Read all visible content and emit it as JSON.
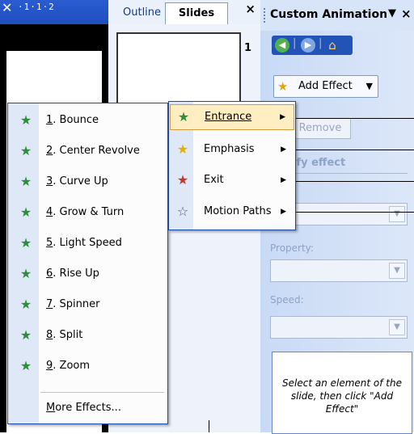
{
  "ruler": {
    "marks": "·1·1·2"
  },
  "pane_tabs": {
    "outline": "Outline",
    "slides": "Slides",
    "close": "×",
    "slide_number": "1"
  },
  "task_pane": {
    "title": "Custom Animation",
    "close": "×",
    "add_effect_label": "Add Effect",
    "remove_label": "Remove",
    "modify_label": "ify effect",
    "property_label": "Property:",
    "speed_label": "Speed:",
    "note_text": "Select an element of the slide, then click \"Add Effect\""
  },
  "submenu": {
    "items": [
      {
        "label": "Entrance",
        "icon": "star-green-icon",
        "color": "#2c8f3a"
      },
      {
        "label": "Emphasis",
        "icon": "star-yellow-icon",
        "color": "#e5b000"
      },
      {
        "label": "Exit",
        "icon": "star-red-icon",
        "color": "#d0322a"
      },
      {
        "label": "Motion Paths",
        "icon": "star-outline-icon",
        "color": "#4b5a7a"
      }
    ]
  },
  "entrance_menu": {
    "items": [
      {
        "num": "1",
        "label": ". Bounce"
      },
      {
        "num": "2",
        "label": ". Center Revolve"
      },
      {
        "num": "3",
        "label": ". Curve Up"
      },
      {
        "num": "4",
        "label": ". Grow & Turn"
      },
      {
        "num": "5",
        "label": ". Light Speed"
      },
      {
        "num": "6",
        "label": ". Rise Up"
      },
      {
        "num": "7",
        "label": ". Spinner"
      },
      {
        "num": "8",
        "label": ". Split"
      },
      {
        "num": "9",
        "label": ". Zoom"
      }
    ],
    "more_m": "M",
    "more_rest": "ore Effects..."
  }
}
